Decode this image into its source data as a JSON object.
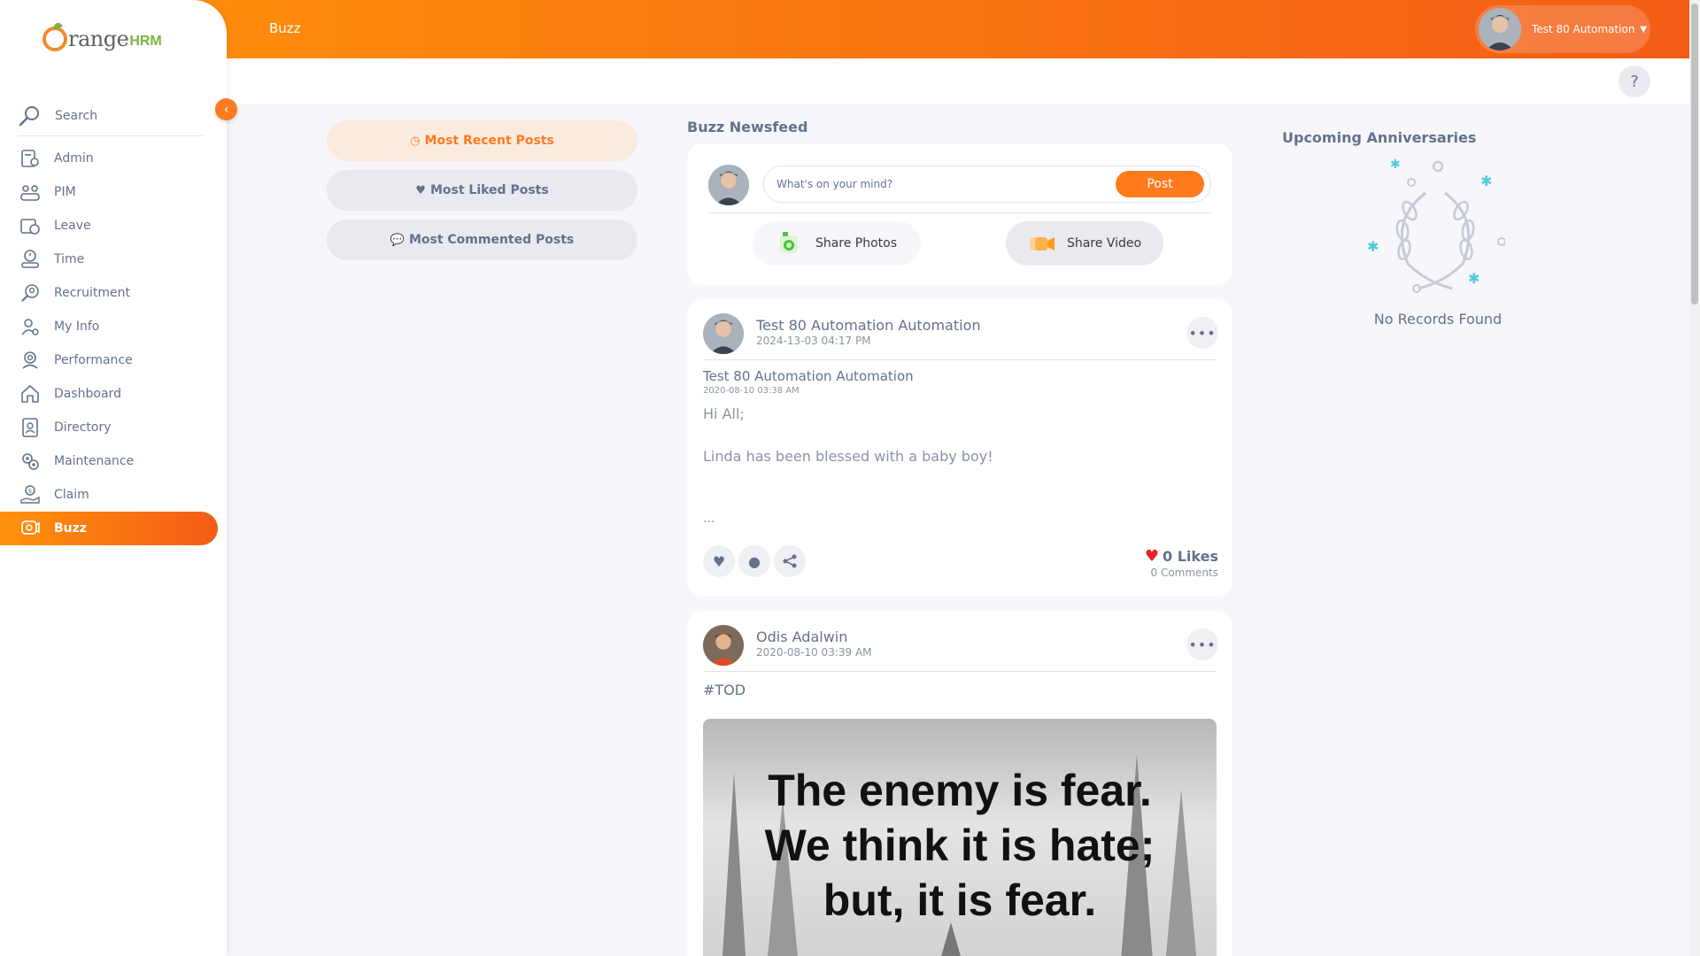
{
  "app": {
    "logo_text": "range",
    "logo_suffix": "HRM",
    "module_title": "Buzz",
    "user_name": "Test 80 Automation",
    "help_label": "?"
  },
  "sidebar": {
    "search_label": "Search",
    "items": [
      {
        "label": "Admin",
        "icon": "admin-icon"
      },
      {
        "label": "PIM",
        "icon": "pim-icon"
      },
      {
        "label": "Leave",
        "icon": "leave-icon"
      },
      {
        "label": "Time",
        "icon": "time-icon"
      },
      {
        "label": "Recruitment",
        "icon": "recruitment-icon"
      },
      {
        "label": "My Info",
        "icon": "my-info-icon"
      },
      {
        "label": "Performance",
        "icon": "performance-icon"
      },
      {
        "label": "Dashboard",
        "icon": "dashboard-icon"
      },
      {
        "label": "Directory",
        "icon": "directory-icon"
      },
      {
        "label": "Maintenance",
        "icon": "maintenance-icon"
      },
      {
        "label": "Claim",
        "icon": "claim-icon"
      },
      {
        "label": "Buzz",
        "icon": "buzz-icon",
        "active": true
      }
    ]
  },
  "filters": {
    "recent": "Most Recent Posts",
    "liked": "Most Liked Posts",
    "commented": "Most Commented Posts"
  },
  "feed": {
    "title": "Buzz Newsfeed",
    "composer_placeholder": "What's on your mind?",
    "post_button": "Post",
    "share_photos": "Share Photos",
    "share_video": "Share Video"
  },
  "posts": [
    {
      "author": "Test 80 Automation Automation",
      "date": "2024-13-03 04:17 PM",
      "shared_author": "Test 80 Automation Automation",
      "shared_date": "2020-08-10 03:38 AM",
      "line1": "Hi All;",
      "line2": "Linda has been blessed with a baby boy!",
      "ellipsis": "...",
      "likes": "0 Likes",
      "comments": "0 Comments"
    },
    {
      "author": "Odis Adalwin",
      "date": "2020-08-10 03:39 AM",
      "hashtag": "#TOD",
      "image_text_1": "The enemy is fear.",
      "image_text_2": "We think it is hate;",
      "image_text_3": "but, it is fear."
    }
  ],
  "anniversaries": {
    "title": "Upcoming Anniversaries",
    "empty": "No Records Found"
  },
  "colors": {
    "accent": "#ff7b1d",
    "gradient_start": "#ff920b",
    "gradient_end": "#f35c17",
    "text": "#64728c",
    "like_heart": "#e3222b"
  }
}
